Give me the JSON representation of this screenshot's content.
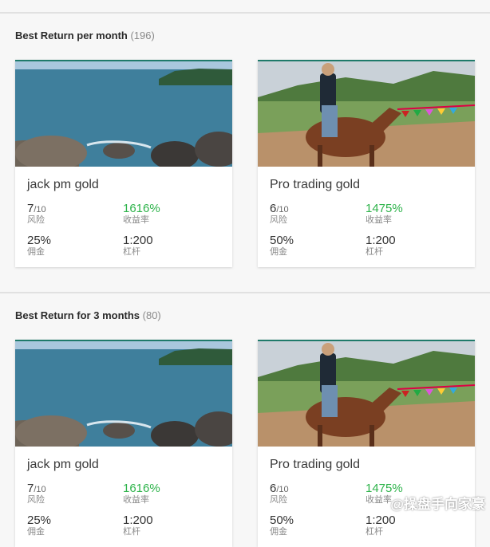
{
  "sections": [
    {
      "title": "Best Return per month",
      "count": "(196)",
      "cards": [
        {
          "name": "jack pm gold",
          "risk": "7",
          "risk_suffix": "/10",
          "risk_label": "风险",
          "return": "1616%",
          "return_label": "收益率",
          "commission": "25%",
          "commission_label": "佣金",
          "leverage": "1:200",
          "leverage_label": "杠杆",
          "image": "sea-rocks"
        },
        {
          "name": "Pro trading gold",
          "risk": "6",
          "risk_suffix": "/10",
          "risk_label": "风险",
          "return": "1475%",
          "return_label": "收益率",
          "commission": "50%",
          "commission_label": "佣金",
          "leverage": "1:200",
          "leverage_label": "杠杆",
          "image": "horse-rider"
        }
      ]
    },
    {
      "title": "Best Return for 3 months",
      "count": "(80)",
      "cards": [
        {
          "name": "jack pm gold",
          "risk": "7",
          "risk_suffix": "/10",
          "risk_label": "风险",
          "return": "1616%",
          "return_label": "收益率",
          "commission": "25%",
          "commission_label": "佣金",
          "leverage": "1:200",
          "leverage_label": "杠杆",
          "image": "sea-rocks"
        },
        {
          "name": "Pro trading gold",
          "risk": "6",
          "risk_suffix": "/10",
          "risk_label": "风险",
          "return": "1475%",
          "return_label": "收益率",
          "commission": "50%",
          "commission_label": "佣金",
          "leverage": "1:200",
          "leverage_label": "杠杆",
          "image": "horse-rider"
        }
      ]
    }
  ],
  "watermark": "@操盘手向家豪",
  "colors": {
    "accent": "#1f7a6a",
    "positive": "#2db34a"
  }
}
